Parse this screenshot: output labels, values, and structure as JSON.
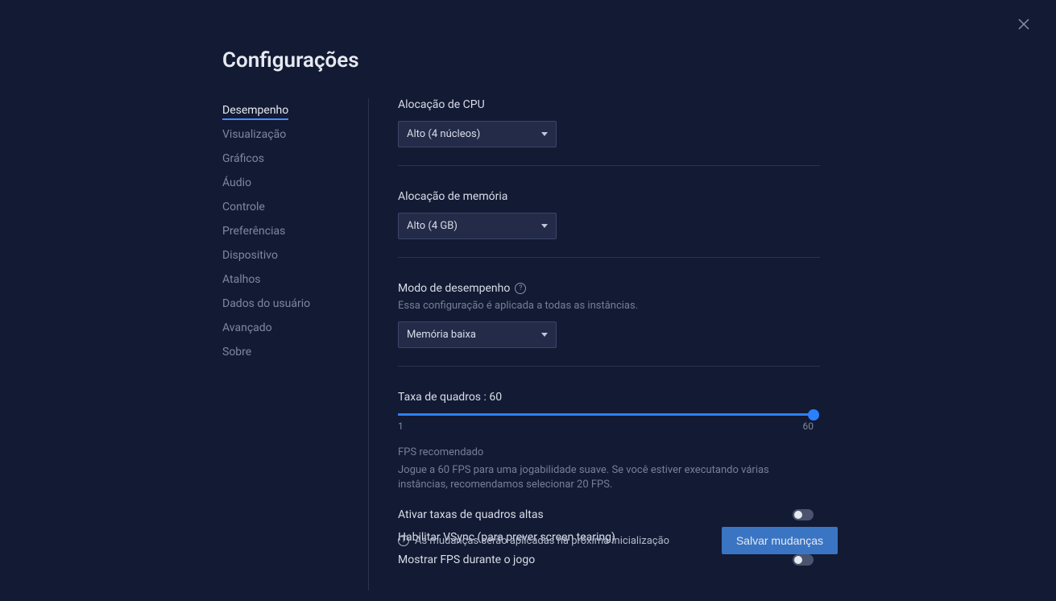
{
  "title": "Configurações",
  "sidebar": {
    "items": [
      {
        "label": "Desempenho",
        "active": true
      },
      {
        "label": "Visualização",
        "active": false
      },
      {
        "label": "Gráficos",
        "active": false
      },
      {
        "label": "Áudio",
        "active": false
      },
      {
        "label": "Controle",
        "active": false
      },
      {
        "label": "Preferências",
        "active": false
      },
      {
        "label": "Dispositivo",
        "active": false
      },
      {
        "label": "Atalhos",
        "active": false
      },
      {
        "label": "Dados do usuário",
        "active": false
      },
      {
        "label": "Avançado",
        "active": false
      },
      {
        "label": "Sobre",
        "active": false
      }
    ]
  },
  "cpu": {
    "label": "Alocação de CPU",
    "value": "Alto (4 núcleos)"
  },
  "memory": {
    "label": "Alocação de memória",
    "value": "Alto (4 GB)"
  },
  "perf_mode": {
    "label": "Modo de desempenho",
    "sublabel": "Essa configuração é aplicada a todas as instâncias.",
    "value": "Memória baixa"
  },
  "fps": {
    "label": "Taxa de quadros : 60",
    "min": "1",
    "max": "60",
    "reco_title": "FPS recomendado",
    "reco_desc": "Jogue a 60 FPS para uma jogabilidade suave. Se você estiver executando várias instâncias, recomendamos selecionar 20 FPS."
  },
  "toggles": {
    "high_fps": "Ativar taxas de quadros altas",
    "vsync": "Habilitar VSync (para prever screen tearing)",
    "show_fps": "Mostrar FPS durante o jogo"
  },
  "footer": {
    "info": "As mudanças serão aplicadas na próxima inicialização",
    "save": "Salvar mudanças"
  }
}
